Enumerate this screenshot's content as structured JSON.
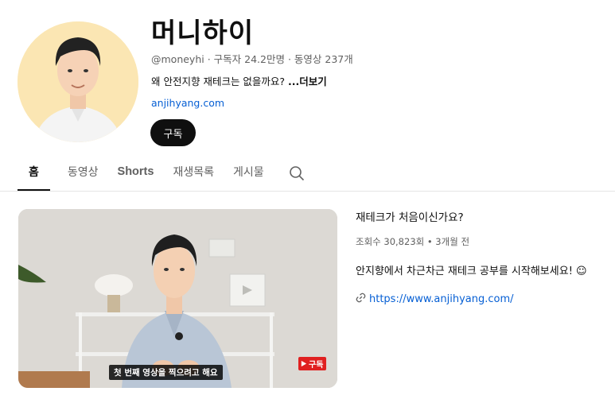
{
  "channel": {
    "name": "머니하이",
    "handle": "@moneyhi",
    "subscribers": "구독자 24.2만명",
    "video_count": "동영상 237개",
    "separator": " · ",
    "description": "왜 안전지향 재테크는 없을까요?",
    "more_label": "...더보기",
    "link": "anjihyang.com",
    "subscribe_label": "구독"
  },
  "tabs": [
    {
      "label": "홈",
      "active": true
    },
    {
      "label": "동영상"
    },
    {
      "label": "Shorts"
    },
    {
      "label": "재생목록"
    },
    {
      "label": "게시물"
    }
  ],
  "icons": {
    "search": "search-icon",
    "link": "link-icon"
  },
  "featured": {
    "title": "재테크가 처음이신가요?",
    "stats": "조회수 30,823회 • 3개월 전",
    "description": "안지향에서 차근차근 재테크 공부를 시작해보세요! ☺",
    "link": "https://www.anjihyang.com/",
    "caption": "첫 번째 영상을 찍으려고 해요",
    "badge": "구독"
  },
  "colors": {
    "accent": "#065fd4",
    "button": "#0f0f0f",
    "avatar_bg": "#fbe6b3",
    "badge": "#e02020"
  }
}
